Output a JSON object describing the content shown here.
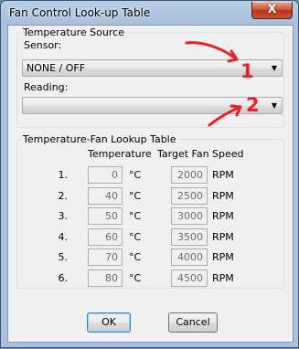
{
  "window": {
    "title": "Fan Control Look-up Table",
    "close_glyph": "X"
  },
  "temperature_source": {
    "legend": "Temperature Source",
    "sensor_label": "Sensor:",
    "sensor_value": "NONE / OFF",
    "reading_label": "Reading:",
    "reading_value": ""
  },
  "lookup_table": {
    "legend": "Temperature-Fan Lookup Table",
    "header_temperature": "Temperature",
    "header_fan_speed": "Target Fan Speed",
    "rows": [
      {
        "index": "1.",
        "temperature": "0",
        "temp_unit": "°C",
        "fan_speed": "2000",
        "speed_unit": "RPM"
      },
      {
        "index": "2.",
        "temperature": "40",
        "temp_unit": "°C",
        "fan_speed": "2500",
        "speed_unit": "RPM"
      },
      {
        "index": "3.",
        "temperature": "50",
        "temp_unit": "°C",
        "fan_speed": "3000",
        "speed_unit": "RPM"
      },
      {
        "index": "4.",
        "temperature": "60",
        "temp_unit": "°C",
        "fan_speed": "3500",
        "speed_unit": "RPM"
      },
      {
        "index": "5.",
        "temperature": "70",
        "temp_unit": "°C",
        "fan_speed": "4000",
        "speed_unit": "RPM"
      },
      {
        "index": "6.",
        "temperature": "80",
        "temp_unit": "°C",
        "fan_speed": "4500",
        "speed_unit": "RPM"
      }
    ]
  },
  "buttons": {
    "ok": "OK",
    "cancel": "Cancel"
  },
  "annotations": {
    "marker_1": "1",
    "marker_2": "2",
    "color": "#e8202a"
  },
  "icons": {
    "combo_arrow": "chevron-down-icon",
    "close": "close-icon"
  }
}
